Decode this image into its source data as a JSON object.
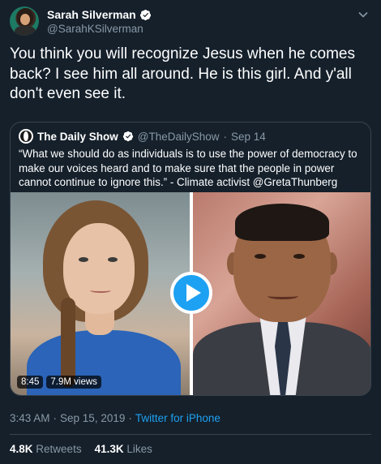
{
  "author": {
    "name": "Sarah Silverman",
    "handle": "@SarahKSilverman"
  },
  "tweet": {
    "text": "You think you will recognize Jesus when he comes back? I see him all around. He is this girl. And y'all don't even see it."
  },
  "quote": {
    "name": "The Daily Show",
    "handle": "@TheDailyShow",
    "separator": "·",
    "date": "Sep 14",
    "text": "“What we should do as individuals is to use the power of democracy to make our voices heard and to make sure that the people in power cannot continue to ignore this.” - Climate activist @GretaThunberg",
    "video": {
      "duration": "8:45",
      "views": "7.9M views"
    }
  },
  "meta": {
    "time": "3:43 AM",
    "date": "Sep 15, 2019",
    "separator": "·",
    "source": "Twitter for iPhone"
  },
  "stats": {
    "retweets_count": "4.8K",
    "retweets_label": "Retweets",
    "likes_count": "41.3K",
    "likes_label": "Likes"
  },
  "colors": {
    "background": "#15202b",
    "accent": "#1da1f2",
    "muted": "#8899a6",
    "border": "#38444d"
  }
}
